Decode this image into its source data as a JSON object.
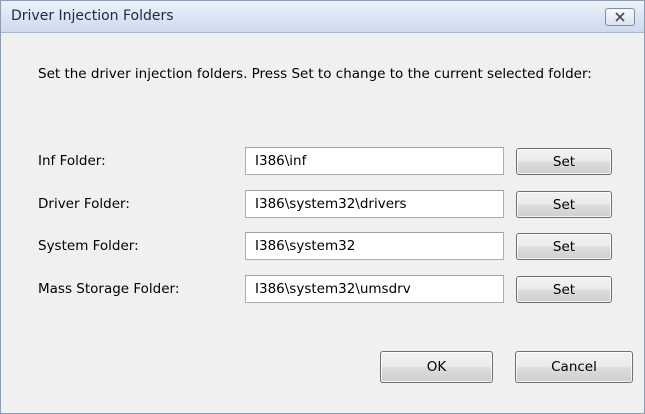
{
  "window": {
    "title": "Driver Injection Folders",
    "close_icon": "close-icon"
  },
  "description": "Set the driver injection folders.  Press Set to change to the current selected folder:",
  "rows": [
    {
      "label": "Inf Folder:",
      "value": "I386\\inf",
      "set_label": "Set"
    },
    {
      "label": "Driver Folder:",
      "value": "I386\\system32\\drivers",
      "set_label": "Set"
    },
    {
      "label": "System Folder:",
      "value": "I386\\system32",
      "set_label": "Set"
    },
    {
      "label": "Mass Storage Folder:",
      "value": "I386\\system32\\umsdrv",
      "set_label": "Set"
    }
  ],
  "buttons": {
    "ok_label": "OK",
    "cancel_label": "Cancel"
  }
}
